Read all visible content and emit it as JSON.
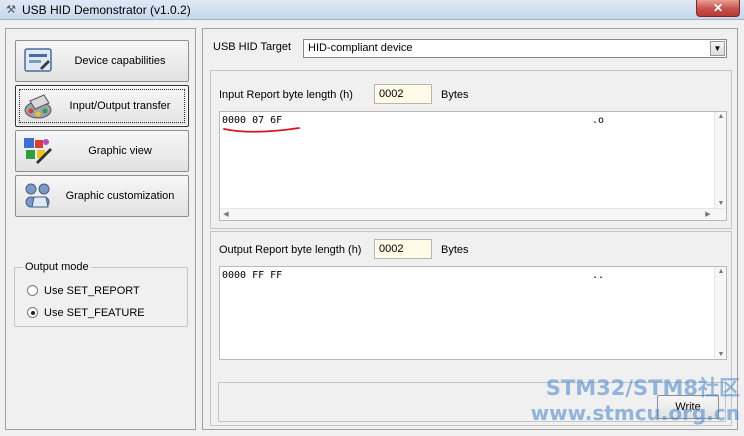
{
  "window": {
    "title": "USB HID Demonstrator (v1.0.2)",
    "close_glyph": "✕"
  },
  "nav": {
    "items": [
      {
        "label": "Device capabilities",
        "icon": "device-card-icon"
      },
      {
        "label": "Input/Output transfer",
        "icon": "usb-transfer-icon"
      },
      {
        "label": "Graphic view",
        "icon": "graphic-view-icon"
      },
      {
        "label": "Graphic customization",
        "icon": "graphic-customization-icon"
      }
    ],
    "active_index": 1
  },
  "output_mode": {
    "title": "Output mode",
    "options": [
      "Use SET_REPORT",
      "Use SET_FEATURE"
    ],
    "selected_index": 1
  },
  "target": {
    "label": "USB HID Target",
    "value": "HID-compliant device"
  },
  "input_report": {
    "length_label": "Input Report byte length  (h)",
    "length_value": "0002",
    "bytes_label": "Bytes",
    "hex_row": "0000 07 6F",
    "ascii_row": ".o"
  },
  "output_report": {
    "length_label": "Output Report byte length  (h)",
    "length_value": "0002",
    "bytes_label": "Bytes",
    "hex_row": "0000 FF FF",
    "ascii_row": ".."
  },
  "write": {
    "label": "Write"
  },
  "watermark": {
    "line1": "STM32/STM8社区",
    "line2": "www.stmcu.org.cn"
  },
  "colors": {
    "annotation_underline": "#d9141b",
    "watermark": "#508ccd"
  }
}
